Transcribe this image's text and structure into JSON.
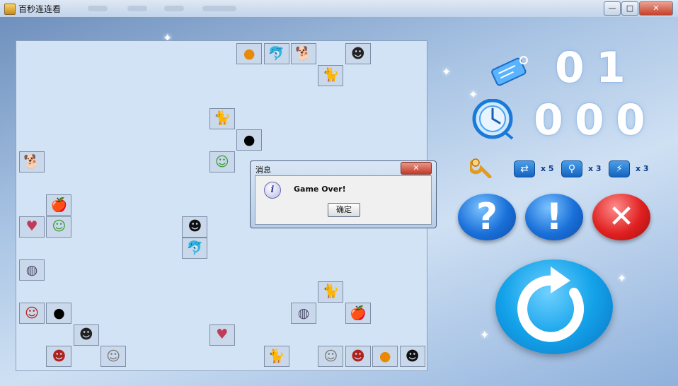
{
  "window": {
    "title": "百秒连连看",
    "controls": {
      "minimize": "—",
      "maximize": "□",
      "close": "✕"
    }
  },
  "board": {
    "tiles": [
      {
        "type": "orange",
        "glyph": "●",
        "row": 0,
        "col": 8
      },
      {
        "type": "dolphin",
        "glyph": "🐬",
        "row": 0,
        "col": 9
      },
      {
        "type": "dog",
        "glyph": "🐕",
        "row": 0,
        "col": 10
      },
      {
        "type": "ghost",
        "glyph": "☻",
        "row": 0,
        "col": 12
      },
      {
        "type": "cat",
        "glyph": "🐈",
        "row": 1,
        "col": 11
      },
      {
        "type": "kitty",
        "glyph": "🐈",
        "row": 3,
        "col": 7
      },
      {
        "type": "bomb",
        "glyph": "●",
        "row": 4,
        "col": 8
      },
      {
        "type": "dog",
        "glyph": "🐕",
        "row": 5,
        "col": 0
      },
      {
        "type": "alien",
        "glyph": "☺",
        "row": 5,
        "col": 7
      },
      {
        "type": "apple",
        "glyph": "🍎",
        "row": 7,
        "col": 1
      },
      {
        "type": "ring",
        "glyph": "♥",
        "row": 8,
        "col": 0
      },
      {
        "type": "alien",
        "glyph": "☺",
        "row": 8,
        "col": 1
      },
      {
        "type": "devil",
        "glyph": "☻",
        "row": 8,
        "col": 6
      },
      {
        "type": "dolphin",
        "glyph": "🐬",
        "row": 9,
        "col": 6
      },
      {
        "type": "ufo",
        "glyph": "◍",
        "row": 10,
        "col": 0
      },
      {
        "type": "cat",
        "glyph": "🐈",
        "row": 11,
        "col": 11
      },
      {
        "type": "guy",
        "glyph": "☺",
        "row": 12,
        "col": 0
      },
      {
        "type": "bomb",
        "glyph": "●",
        "row": 12,
        "col": 1
      },
      {
        "type": "ufo",
        "glyph": "◍",
        "row": 12,
        "col": 10
      },
      {
        "type": "apple",
        "glyph": "🍎",
        "row": 12,
        "col": 12
      },
      {
        "type": "ghost",
        "glyph": "☻",
        "row": 13,
        "col": 2
      },
      {
        "type": "ring",
        "glyph": "♥",
        "row": 13,
        "col": 7
      },
      {
        "type": "guy",
        "glyph": "☻",
        "row": 14,
        "col": 1
      },
      {
        "type": "cook",
        "glyph": "☺",
        "row": 14,
        "col": 3
      },
      {
        "type": "kitty",
        "glyph": "🐈",
        "row": 14,
        "col": 9
      },
      {
        "type": "cook",
        "glyph": "☺",
        "row": 14,
        "col": 11
      },
      {
        "type": "guy",
        "glyph": "☻",
        "row": 14,
        "col": 12
      },
      {
        "type": "orange",
        "glyph": "●",
        "row": 14,
        "col": 13
      },
      {
        "type": "devil",
        "glyph": "☻",
        "row": 14,
        "col": 14
      }
    ]
  },
  "dialog": {
    "title": "消息",
    "close": "✕",
    "icon": "i",
    "message": "Game Over!",
    "ok_label": "确定"
  },
  "status": {
    "level_digits": [
      "0",
      "1"
    ],
    "time_digits": [
      "0",
      "0",
      "0"
    ]
  },
  "props": {
    "refresh_count": "x 5",
    "hint_count": "x 3",
    "bomb_count": "x 3"
  },
  "buttons": {
    "help": "?",
    "tip": "!",
    "exit": "✕"
  },
  "colors": {
    "board_bg": "#d3e3f6",
    "accent_blue": "#1a70d9",
    "exit_red": "#e02020"
  }
}
